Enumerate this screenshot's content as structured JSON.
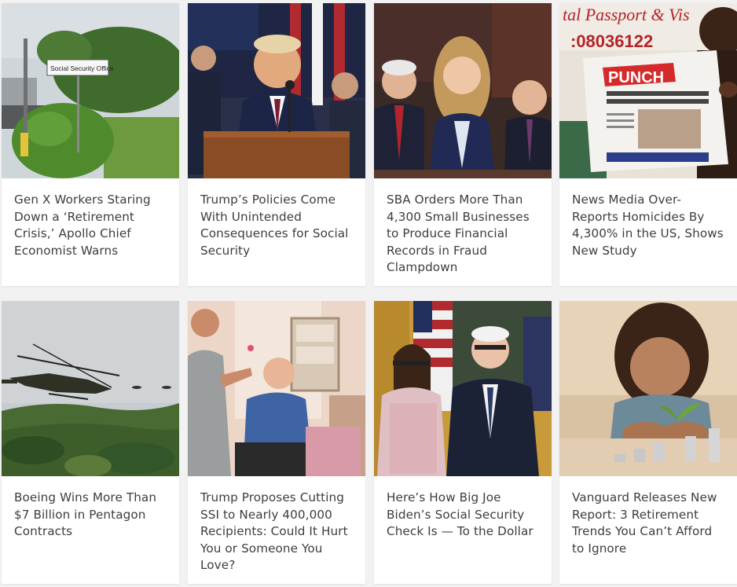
{
  "articles": [
    {
      "title": "Gen X Workers Staring Down a ‘Retirement Crisis,’ Apollo Chief Economist Warns",
      "image_sign": "Social Security Office"
    },
    {
      "title": "Trump’s Policies Come With Unintended Consequences for Social Security"
    },
    {
      "title": "SBA Orders More Than 4,300 Small Businesses to Produce Financial Records in Fraud Clampdown"
    },
    {
      "title": "News Media Over-Reports Homicides By 4,300% in the US, Shows New Study",
      "image_masthead": "PUNCH",
      "image_phone": ":08036122"
    },
    {
      "title": "Boeing Wins More Than $7 Billion in Pentagon Contracts"
    },
    {
      "title": "Trump Proposes Cutting SSI to Nearly 400,000 Recipients: Could It Hurt You or Someone You Love?"
    },
    {
      "title": "Here’s How Big Joe Biden’s Social Security Check Is — To the Dollar"
    },
    {
      "title": "Vanguard Releases New Report: 3 Retirement Trends You Can’t Afford to Ignore"
    }
  ]
}
